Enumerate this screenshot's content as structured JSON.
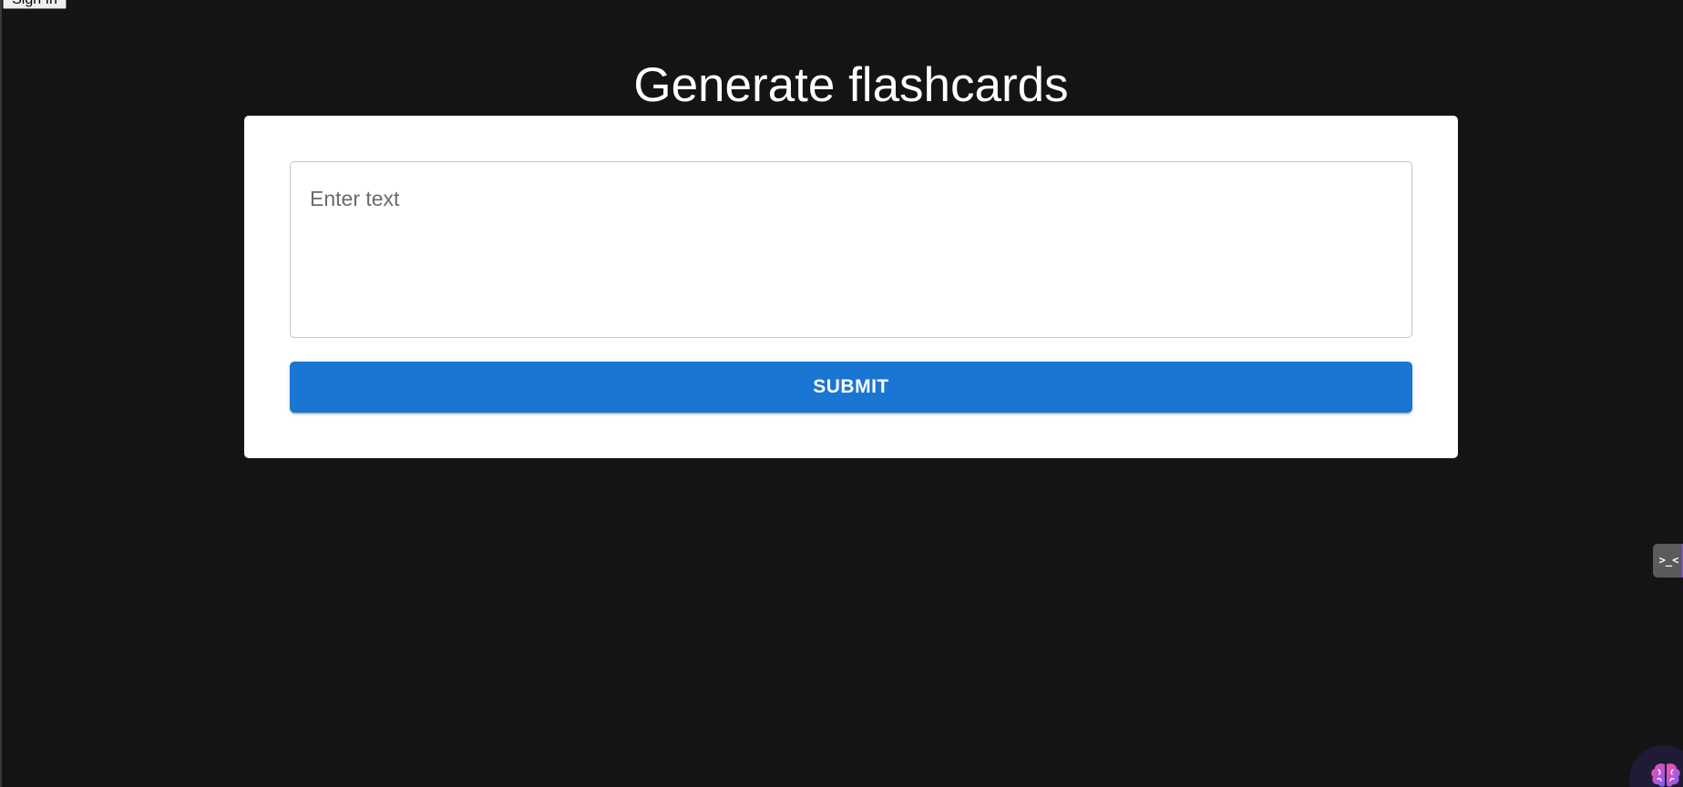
{
  "header": {
    "signin_label": "Sign In"
  },
  "main": {
    "title": "Generate flashcards",
    "input": {
      "placeholder": "Enter text",
      "value": ""
    },
    "submit_label": "Submit"
  },
  "extensions": {
    "tab_glyph": ">_<",
    "brain_icon": "brain-icon"
  },
  "colors": {
    "background": "#141414",
    "card": "#ffffff",
    "accent": "#1976d2",
    "text_light": "#ffffff"
  }
}
